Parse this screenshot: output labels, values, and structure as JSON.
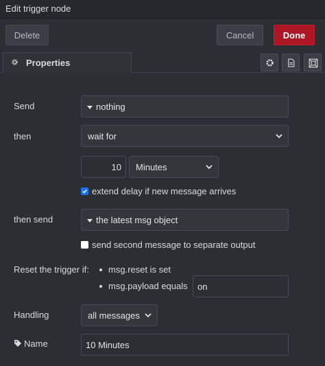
{
  "window": {
    "title": "Edit trigger node"
  },
  "buttons": {
    "delete": "Delete",
    "cancel": "Cancel",
    "done": "Done"
  },
  "tabs": [
    {
      "label": "Properties",
      "icon": "gear-icon"
    }
  ],
  "tab_icons": [
    "gear-icon",
    "document-icon",
    "frame-icon"
  ],
  "form": {
    "send": {
      "label": "Send",
      "value": "nothing"
    },
    "then": {
      "label": "then",
      "value": "wait for"
    },
    "duration": {
      "value": "10",
      "unit": "Minutes"
    },
    "extend_delay": {
      "label": "extend delay if new message arrives",
      "checked": true
    },
    "then_send": {
      "label": "then send",
      "value": "the latest msg object"
    },
    "second_output": {
      "label": "send second message to separate output",
      "checked": false
    },
    "reset": {
      "label": "Reset the trigger if:",
      "conditions": [
        "msg.reset is set",
        "msg.payload equals"
      ],
      "payload_value": "on"
    },
    "handling": {
      "label": "Handling",
      "value": "all messages"
    },
    "name": {
      "label": "Name",
      "value": "10 Minutes",
      "icon": "tag-icon"
    }
  },
  "colors": {
    "done_bg": "#ad1625",
    "checkbox_on": "#1a73e8"
  }
}
